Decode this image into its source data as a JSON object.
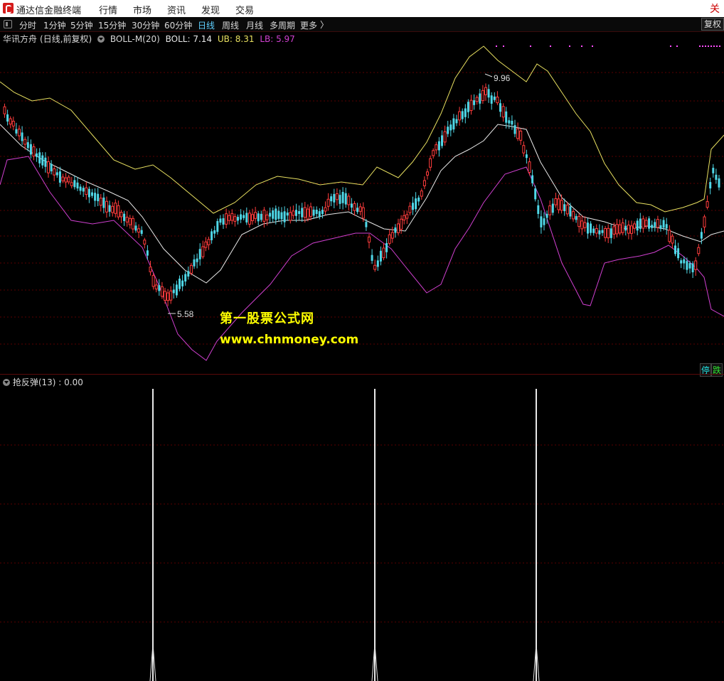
{
  "window": {
    "app_title": "通达信金融终端",
    "menu": [
      "行情",
      "市场",
      "资讯",
      "发现",
      "交易"
    ],
    "close_glyph": "关"
  },
  "toolbar": {
    "periods": [
      "分时",
      "1分钟",
      "5分钟",
      "15分钟",
      "30分钟",
      "60分钟",
      "日线",
      "周线",
      "月线",
      "多周期",
      "更多"
    ],
    "active_period": "日线",
    "restore_label": "复权"
  },
  "main_chart": {
    "stock": "华讯方舟",
    "mode": "(日线,前复权)",
    "indicator": "BOLL-M(20)",
    "boll_label": "BOLL: 7.14",
    "ub_label": "UB: 8.31",
    "lb_label": "LB: 5.97",
    "low_annotation": "5.58",
    "high_annotation": "9.96",
    "colors": {
      "up": "#ff3c3c",
      "down": "#4fd8e8",
      "mid": "#e8e8e8",
      "upper": "#e8e060",
      "lower": "#d040d0",
      "grid": "#5a0000"
    }
  },
  "watermark": {
    "title": "第一股票公式网",
    "url": "www.chnmoney.com"
  },
  "badges": {
    "stop": "停",
    "fall": "跌"
  },
  "sub_chart": {
    "indicator_label": "抢反弹(13) : 0.00",
    "spike_value": 1,
    "base_value": 0
  }
}
